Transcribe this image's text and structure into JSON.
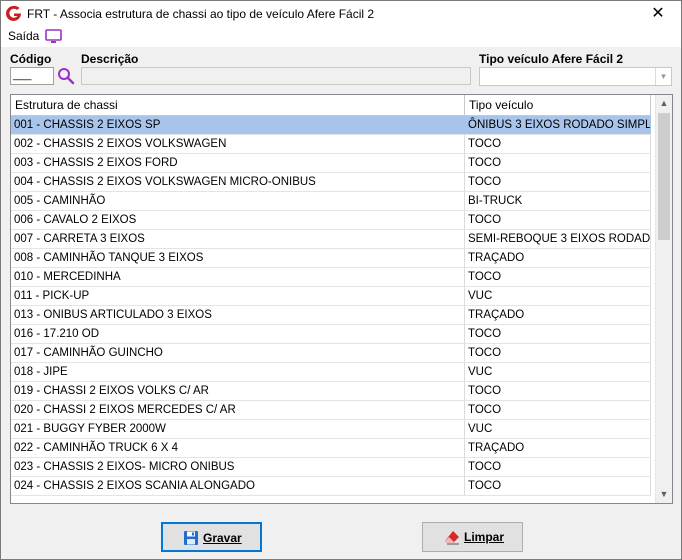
{
  "window": {
    "title": "FRT - Associa estrutura de chassi ao tipo de veículo Afere Fácil 2",
    "close_glyph": "✕",
    "app_icon": "frt-logo-icon",
    "accent_color": "#c82020"
  },
  "menu": {
    "saida_label": "Saída",
    "monitor_icon": "monitor-icon"
  },
  "filters": {
    "codigo_label": "Código",
    "codigo_value": "___",
    "descricao_label": "Descrição",
    "descricao_value": "",
    "tipo_label": "Tipo veículo Afere Fácil 2",
    "tipo_value": ""
  },
  "grid": {
    "columns": [
      "Estrutura de chassi",
      "Tipo veículo"
    ],
    "selected_index": 0,
    "selection_color": "#a8c4ea",
    "rows": [
      [
        "001 - CHASSIS 2 EIXOS SP",
        "ÔNIBUS 3 EIXOS RODADO SIMPL..."
      ],
      [
        "002 - CHASSIS 2 EIXOS VOLKSWAGEN",
        "TOCO"
      ],
      [
        "003 - CHASSIS  2 EIXOS FORD",
        "TOCO"
      ],
      [
        "004 - CHASSIS 2 EIXOS VOLKSWAGEN MICRO-ONIBUS",
        "TOCO"
      ],
      [
        "005 - CAMINHÃO",
        "BI-TRUCK"
      ],
      [
        "006 - CAVALO 2 EIXOS",
        "TOCO"
      ],
      [
        "007 - CARRETA 3 EIXOS",
        "SEMI-REBOQUE 3 EIXOS RODAD..."
      ],
      [
        "008 - CAMINHÃO TANQUE 3 EIXOS",
        "TRAÇADO"
      ],
      [
        "010 - MERCEDINHA",
        "TOCO"
      ],
      [
        "011 - PICK-UP",
        "VUC"
      ],
      [
        "013 - ONIBUS ARTICULADO 3 EIXOS",
        "TRAÇADO"
      ],
      [
        "016 - 17.210 OD",
        "TOCO"
      ],
      [
        "017 - CAMINHÃO GUINCHO",
        "TOCO"
      ],
      [
        "018 - JIPE",
        "VUC"
      ],
      [
        "019 - CHASSI 2 EIXOS VOLKS C/ AR",
        "TOCO"
      ],
      [
        "020 - CHASSI 2 EIXOS MERCEDES C/ AR",
        "TOCO"
      ],
      [
        "021 - BUGGY FYBER 2000W",
        "VUC"
      ],
      [
        "022 - CAMINHÃO TRUCK 6 X 4",
        "TRAÇADO"
      ],
      [
        "023 - CHASSIS 2 EIXOS- MICRO ONIBUS",
        "TOCO"
      ],
      [
        "024 - CHASSIS 2 EIXOS SCANIA ALONGADO",
        "TOCO"
      ]
    ]
  },
  "scrollbar": {
    "position_fraction": 0.0,
    "up_glyph": "▲",
    "down_glyph": "▼"
  },
  "buttons": {
    "gravar_label": "Gravar",
    "gravar_icon": "floppy-disk-icon",
    "limpar_label": "Limpar",
    "limpar_icon": "eraser-icon"
  }
}
